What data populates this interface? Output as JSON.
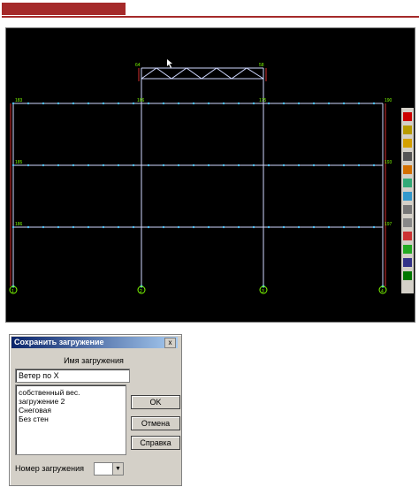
{
  "canvas": {
    "node_labels": {
      "top": [
        "64",
        "58"
      ],
      "left": [
        "183",
        "185",
        "186"
      ],
      "right": [
        "190",
        "193",
        "197"
      ],
      "inner": [
        "166",
        "175"
      ],
      "bottom": [
        "1",
        "2",
        "3",
        "4"
      ]
    },
    "colors": {
      "frame": "#cfd8ff",
      "node": "#4fc3f7",
      "support": "#d32f2f",
      "label": "#7cfc00"
    }
  },
  "toolbar": {
    "icons": [
      "select-icon",
      "edit-node-icon",
      "move-icon",
      "scissors-icon",
      "rotate-icon",
      "copy-icon",
      "cube-icon",
      "grid-icon",
      "table-icon",
      "zoom-icon",
      "sphere-icon",
      "settings-icon",
      "frame-icon"
    ]
  },
  "dialog": {
    "title": "Сохранить загружение",
    "close": "x",
    "name_label": "Имя загружения",
    "name_value": "Ветер по X",
    "list": [
      "собственный вес.",
      "загружение 2",
      "Снеговая",
      "Без стен"
    ],
    "ok": "OK",
    "cancel": "Отмена",
    "help": "Справка",
    "number_label": "Номер загружения"
  }
}
